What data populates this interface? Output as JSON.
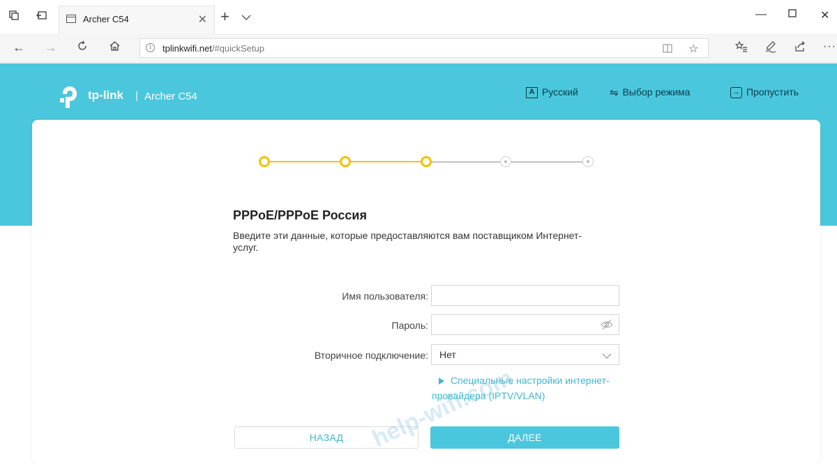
{
  "browser": {
    "tab_title": "Archer C54",
    "url_host": "tplinkwifi.net",
    "url_path": "/#quickSetup"
  },
  "header": {
    "brand": "tp-link",
    "separator": "|",
    "model": "Archer C54",
    "links": {
      "language": "Русский",
      "mode": "Выбор режима",
      "skip": "Пропустить"
    },
    "language_icon_glyph": "A"
  },
  "stepper": {
    "total_steps": 5,
    "completed_steps": 3,
    "active_color": "#f5c100",
    "inactive_color": "#cfcfcf"
  },
  "form": {
    "title": "PPPoE/PPPoE Россия",
    "description": "Введите эти данные, которые предоставляются вам поставщиком Интернет-услуг.",
    "username_label": "Имя пользователя:",
    "username_value": "",
    "password_label": "Пароль:",
    "password_value": "",
    "secondary_label": "Вторичное подключение:",
    "secondary_value": "Нет",
    "advanced_link": "Специальные настройки интернет-провайдера (IPTV/VLAN)"
  },
  "buttons": {
    "back": "НАЗАД",
    "next": "ДАЛЕЕ"
  },
  "watermark": "help-wifi.com",
  "colors": {
    "accent": "#4ac7dc",
    "link": "#3fb7cd",
    "step_done": "#f5c100"
  }
}
